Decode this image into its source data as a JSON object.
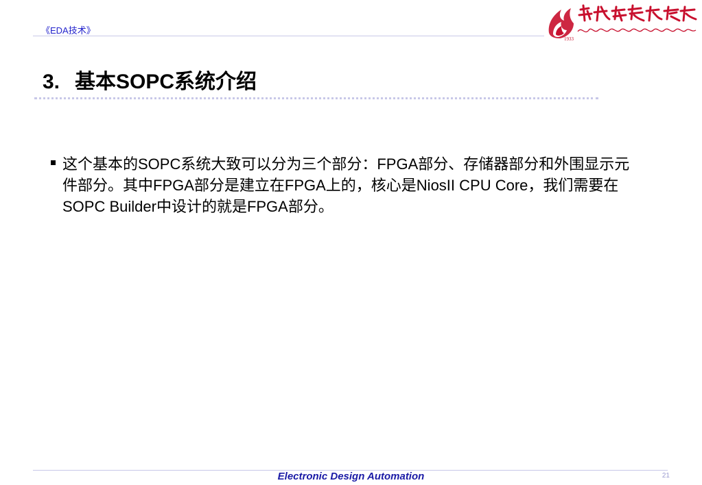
{
  "header": {
    "course_label": "《EDA技术》"
  },
  "logo": {
    "name": "hanyang-college-logo"
  },
  "slide": {
    "title_number": "3.",
    "title_text": "基本SOPC系统介绍",
    "bullet": "这个基本的SOPC系统大致可以分为三个部分：FPGA部分、存储器部分和外围显示元件部分。其中FPGA部分是建立在FPGA上的，核心是NiosII CPU Core，我们需要在SOPC Builder中设计的就是FPGA部分。"
  },
  "footer": {
    "text": "Electronic Design Automation",
    "page_number": "21"
  },
  "colors": {
    "header_text": "#2222cc",
    "footer_text": "#1a1aa6",
    "rule": "#c8c8e8",
    "logo_red": "#c8102e"
  }
}
